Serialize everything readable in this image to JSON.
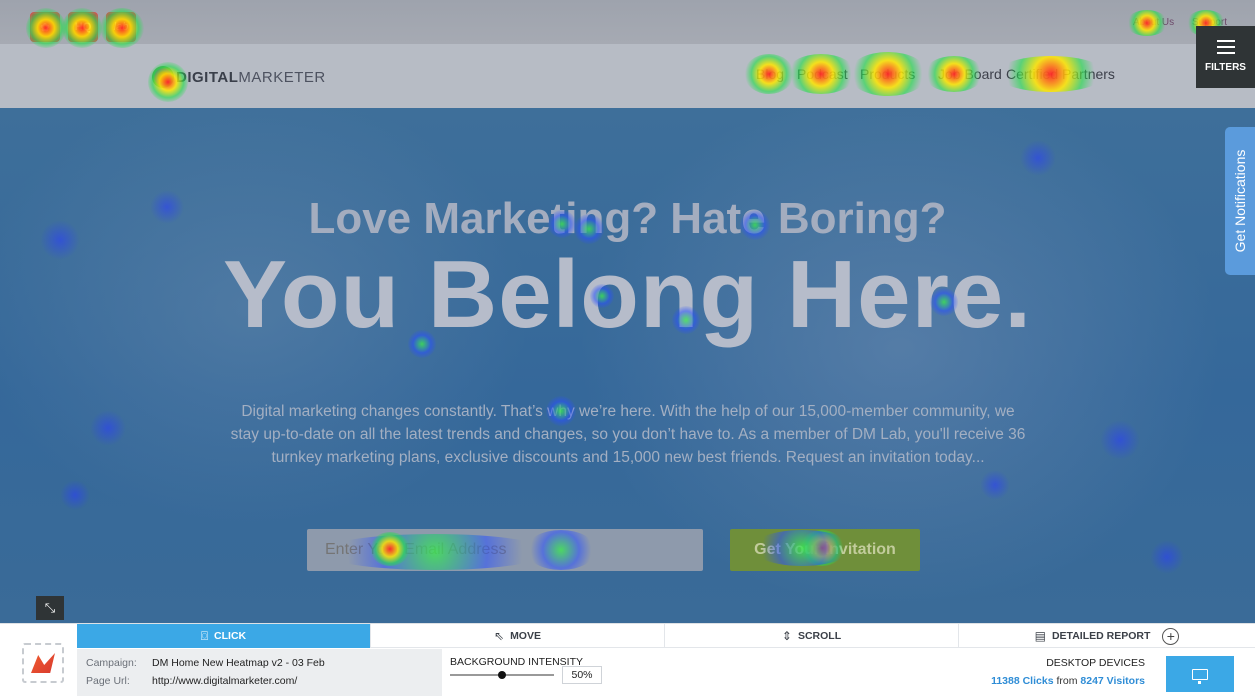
{
  "site": {
    "top_icons": [
      "HQ",
      "lab"
    ],
    "top_links": [
      "About Us",
      "Support"
    ],
    "logo_bold": "DIGITAL",
    "logo_regular": "MARKETER",
    "nav": [
      "Blog",
      "Podcast",
      "Products",
      "Job Board",
      "Certified Partners"
    ],
    "hero_headline": "Love Marketing? Hate Boring?",
    "hero_big": "You Belong Here.",
    "hero_paragraph": "Digital marketing changes constantly. That’s why we’re here. With the help of our 15,000-member community, we stay up-to-date on all the latest trends and changes, so you don’t have to. As a member of DM Lab, you'll receive 36 turnkey marketing plans, exclusive discounts and 15,000 new best friends. Request an invitation today...",
    "email_placeholder": "Enter Your Email Address",
    "invite_button": "Get Your Invitation"
  },
  "widgets": {
    "filters_label": "FILTERS",
    "notifications_label": "Get Notifications"
  },
  "panel": {
    "tabs": {
      "click": "CLICK",
      "move": "MOVE",
      "scroll": "SCROLL",
      "report": "DETAILED REPORT"
    },
    "campaign_key": "Campaign:",
    "campaign_value": "DM Home New Heatmap v2 - 03 Feb",
    "url_key": "Page Url:",
    "url_value": "http://www.digitalmarketer.com/",
    "intensity_label": "BACKGROUND INTENSITY",
    "intensity_value": "50%",
    "intensity_fraction": 0.5,
    "devices_title": "DESKTOP DEVICES",
    "clicks": "11388 Clicks",
    "from_text": "from",
    "visitors": "8247 Visitors"
  },
  "colors": {
    "accent": "#3ba8e6",
    "hero": "#35689a",
    "invite": "#6f8f3a"
  }
}
